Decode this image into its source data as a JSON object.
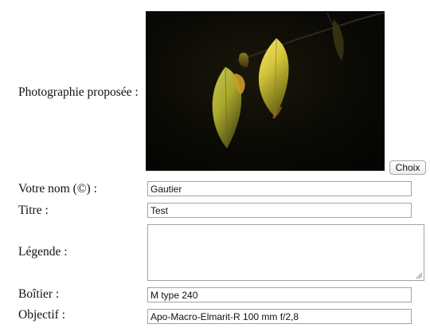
{
  "form": {
    "photo_label": "Photographie proposée :",
    "choose_button": "Choix",
    "name_label": "Votre nom (©) :",
    "name_value": "Gautier",
    "title_label": "Titre :",
    "title_value": "Test",
    "caption_label": "Légende :",
    "caption_value": "",
    "body_label": "Boîtier :",
    "body_value": "M type 240",
    "lens_label": "Objectif :",
    "lens_value": "Apo-Macro-Elmarit-R 100 mm f/2,8"
  }
}
